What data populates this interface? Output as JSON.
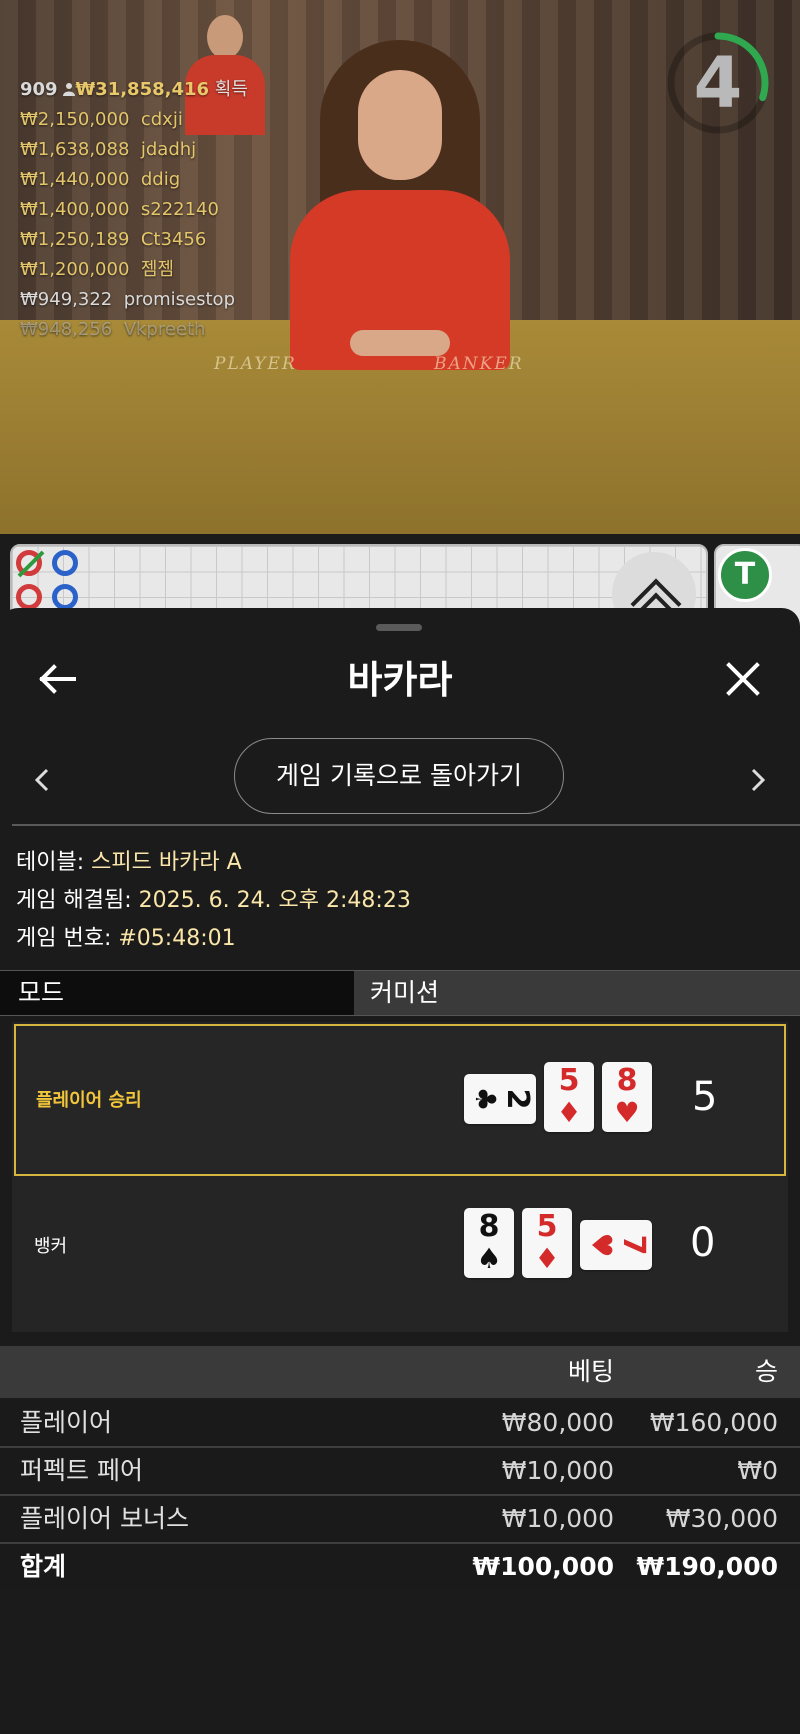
{
  "video": {
    "player_count": "909",
    "total_won": "₩31,858,416",
    "won_label": "획득",
    "winners": [
      {
        "amount": "₩2,150,000",
        "name": "cdxji"
      },
      {
        "amount": "₩1,638,088",
        "name": "jdadhj"
      },
      {
        "amount": "₩1,440,000",
        "name": "ddig"
      },
      {
        "amount": "₩1,400,000",
        "name": "s222140"
      },
      {
        "amount": "₩1,250,189",
        "name": "Ct3456"
      },
      {
        "amount": "₩1,200,000",
        "name": "젬젬"
      },
      {
        "amount": "₩949,322",
        "name": "promisestop"
      },
      {
        "amount": "₩948,256",
        "name": "Vkpreeth"
      }
    ],
    "table_labels": {
      "player": "PLAYER",
      "banker": "BANKER"
    },
    "timer": "4",
    "timer_progress": 0.3
  },
  "roadmap": {
    "tie_badge": "T"
  },
  "sheet": {
    "title": "바카라",
    "back_to_history": "게임 기록으로 돌아가기",
    "info": {
      "table_label": "테이블:",
      "table_value": "스피드 바카라 A",
      "resolved_label": "게임 해결됨:",
      "resolved_value": "2025. 6. 24. 오후 2:48:23",
      "game_no_label": "게임 번호:",
      "game_no_value": "#05:48:01"
    },
    "tabs": {
      "mode": "모드",
      "commission": "커미션"
    },
    "results": {
      "player": {
        "label": "플레이어 승리",
        "score": "5",
        "cards": [
          {
            "rank": "2",
            "suit": "♣",
            "color": "black",
            "sideways": true
          },
          {
            "rank": "5",
            "suit": "♦",
            "color": "red"
          },
          {
            "rank": "8",
            "suit": "♥",
            "color": "red"
          }
        ]
      },
      "banker": {
        "label": "뱅커",
        "score": "0",
        "cards": [
          {
            "rank": "8",
            "suit": "♠",
            "color": "black"
          },
          {
            "rank": "5",
            "suit": "♦",
            "color": "red"
          },
          {
            "rank": "7",
            "suit": "♥",
            "color": "red",
            "sideways": true
          }
        ]
      }
    },
    "bets": {
      "header_bet": "베팅",
      "header_win": "승",
      "rows": [
        {
          "name": "플레이어",
          "bet": "₩80,000",
          "win": "₩160,000"
        },
        {
          "name": "퍼펙트 페어",
          "bet": "₩10,000",
          "win": "₩0"
        },
        {
          "name": "플레이어 보너스",
          "bet": "₩10,000",
          "win": "₩30,000"
        }
      ],
      "total": {
        "name": "합계",
        "bet": "₩100,000",
        "win": "₩190,000"
      }
    }
  },
  "colors": {
    "accent_gold": "#d6b63c",
    "player_win": "#f2c63b",
    "timer_green": "#2fa84f",
    "info_value": "#fbe6a9"
  }
}
